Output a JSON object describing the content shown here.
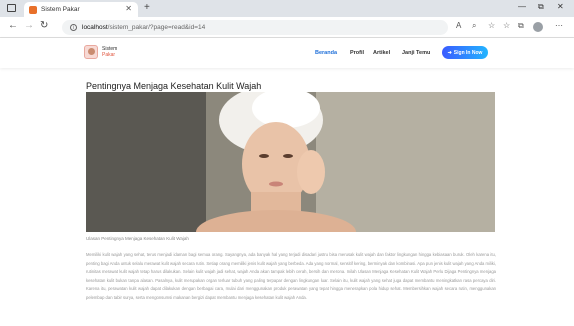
{
  "browser": {
    "tab_title": "Sistem Pakar",
    "url_host": "localhost",
    "url_path": "/sistem_pakar/?page=read&id=14"
  },
  "site": {
    "logo_line1": "Sistem",
    "logo_line2": "Pakar",
    "nav": [
      "Beranda",
      "Profil",
      "Artikel",
      "Janji Temu"
    ],
    "signin_label": "Sign In Now"
  },
  "article": {
    "title": "Pentingnya Menjaga Kesehatan Kulit Wajah",
    "caption": "Ulasan Pentingnya Menjaga Kesehatan Kulit Wajah",
    "body": "Memiliki kulit wajah yang sehat, terus menjadi idaman bagi semua orang. Sayangnya, ada banyak hal yang terjadi disadari justru bisa merusak kulit wajah dan faktor lingkungan hingga kebiasaan buruk. Oleh karena itu, penting bagi Anda untuk selalu merawat kulit wajah secara rutin. Setiap orang memiliki jenis kulit wajah yang berbeda. Ada yang normal, sensitif kering, berminyak dan kombinasi. Apa pun jenis kulit wajah yang Anda miliki, rutinitas merawat kulit wajah tetap harus dilakukan. Selain kulit wajah jadi sehat, wajah Anda akan tampak lebih cerah, bersih dan merona. Inilah Ulasan Menjaga Kesehatan Kulit Wajah Perlu Dijaga Pentingnya menjaga kesehatan kulit bukan tanpa alasan. Pasalnya, kulit merupakan organ terluar tubuh yang paling terpapar dengan lingkungan luar. Selain itu, kulit wajah yang sehat juga dapat membantu meningkatkan rasa percaya diri. Karena itu, perawatan kulit wajah dapat dilakukan dengan berbagai cara, mulai dari menggunakan produk perawatan yang tepat hingga menerapkan pola hidup sehat. Membersihkan wajah secara rutin, menggunakan pelembap dan tabir surya, serta mengonsumsi makanan bergizi dapat membantu menjaga kesehatan kulit wajah Anda."
  }
}
